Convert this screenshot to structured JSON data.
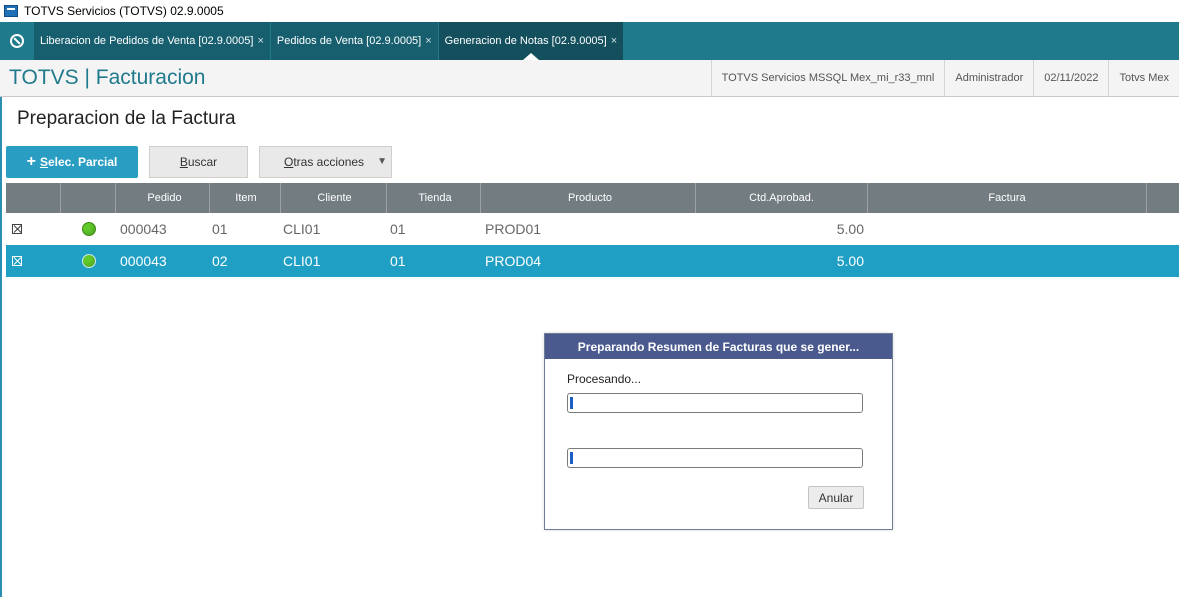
{
  "window": {
    "title": "TOTVS Servicios (TOTVS) 02.9.0005"
  },
  "tabs": [
    {
      "label": "Liberacion de Pedidos de Venta [02.9.0005]",
      "close": "×"
    },
    {
      "label": "Pedidos de Venta [02.9.0005]",
      "close": "×"
    },
    {
      "label": "Generacion de Notas [02.9.0005]",
      "close": "×",
      "active": true
    }
  ],
  "header": {
    "title": "TOTVS | Facturacion",
    "environment": "TOTVS Servicios MSSQL Mex_mi_r33_mnl",
    "user": "Administrador",
    "date": "02/11/2022",
    "company": "Totvs Mex"
  },
  "page": {
    "title": "Preparacion de la Factura"
  },
  "toolbar": {
    "selec_parcial_plus": "+",
    "selec_parcial_underline": "S",
    "selec_parcial_rest": "elec. Parcial",
    "buscar_underline": "B",
    "buscar_rest": "uscar",
    "otras_underline": "O",
    "otras_rest": "tras acciones",
    "caret": "▼"
  },
  "grid": {
    "columns": [
      "",
      "",
      "Pedido",
      "Item",
      "Cliente",
      "Tienda",
      "Producto",
      "Ctd.Aprobad.",
      "Factura",
      ""
    ],
    "rows": [
      {
        "pedido": "000043",
        "item": "01",
        "cliente": "CLI01",
        "tienda": "01",
        "producto": "PROD01",
        "ctd": "5.00",
        "factura": "",
        "checked": true,
        "status": "green",
        "selected": false
      },
      {
        "pedido": "000043",
        "item": "02",
        "cliente": "CLI01",
        "tienda": "01",
        "producto": "PROD04",
        "ctd": "5.00",
        "factura": "",
        "checked": true,
        "status": "green",
        "selected": true
      }
    ]
  },
  "dialog": {
    "title": "Preparando Resumen de Facturas que se gener...",
    "label": "Procesando...",
    "progress1": 0.01,
    "progress2": 0.01,
    "cancel_label": "Anular"
  },
  "colors": {
    "tabbar": "#1f7a8c",
    "accent": "#2a9dc3",
    "selected_row": "#1f9fc4",
    "dialog_title": "#4a5a8f",
    "status_green": "#62c92a"
  }
}
